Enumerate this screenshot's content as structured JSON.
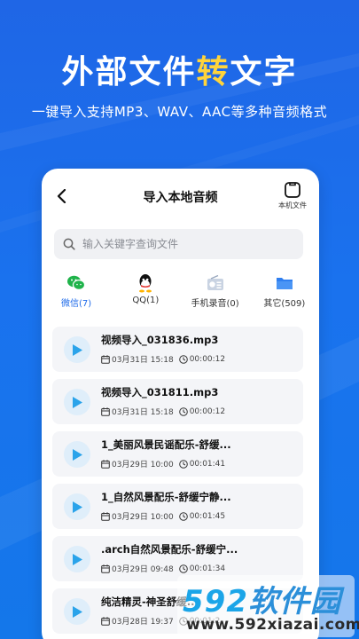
{
  "promo": {
    "headline_part1": "外部文件",
    "headline_highlight": "转",
    "headline_part2": "文字",
    "subline": "一键导入支持MP3、WAV、AAC等多种音频格式"
  },
  "screen": {
    "title": "导入本地音频",
    "local_file_label": "本机文件"
  },
  "search": {
    "placeholder": "输入关键字查询文件"
  },
  "tabs": [
    {
      "label": "微信(7)",
      "icon": "wechat-icon",
      "active": true
    },
    {
      "label": "QQ(1)",
      "icon": "qq-icon",
      "active": false
    },
    {
      "label": "手机录音(0)",
      "icon": "radio-recorder-icon",
      "active": false
    },
    {
      "label": "其它(509)",
      "icon": "folder-icon",
      "active": false
    }
  ],
  "files": [
    {
      "name": "视频导入_031836.mp3",
      "date": "03月31日 15:18",
      "duration": "00:00:12"
    },
    {
      "name": "视频导入_031811.mp3",
      "date": "03月31日 15:18",
      "duration": "00:00:12"
    },
    {
      "name": "1_美丽风景民谣配乐-舒缓...",
      "date": "03月29日 10:00",
      "duration": "00:01:41"
    },
    {
      "name": "1_自然风景配乐-舒缓宁静...",
      "date": "03月29日 10:00",
      "duration": "00:01:45"
    },
    {
      "name": ".arch自然风景配乐-舒缓宁...",
      "date": "03月29日 09:48",
      "duration": "00:01:34"
    },
    {
      "name": "纯洁精灵-神圣舒缓...",
      "date": "03月28日 19:37",
      "duration": "00:01:2"
    }
  ],
  "watermark": {
    "logo_num": "592",
    "logo_cn": "软件园",
    "url": "www.592xiazai.com"
  },
  "colors": {
    "background": "#1a72ee",
    "accent": "#1e6ae9",
    "highlight": "#ffd43b",
    "play_button": "#2aa3ea",
    "wechat": "#1fb34a"
  }
}
